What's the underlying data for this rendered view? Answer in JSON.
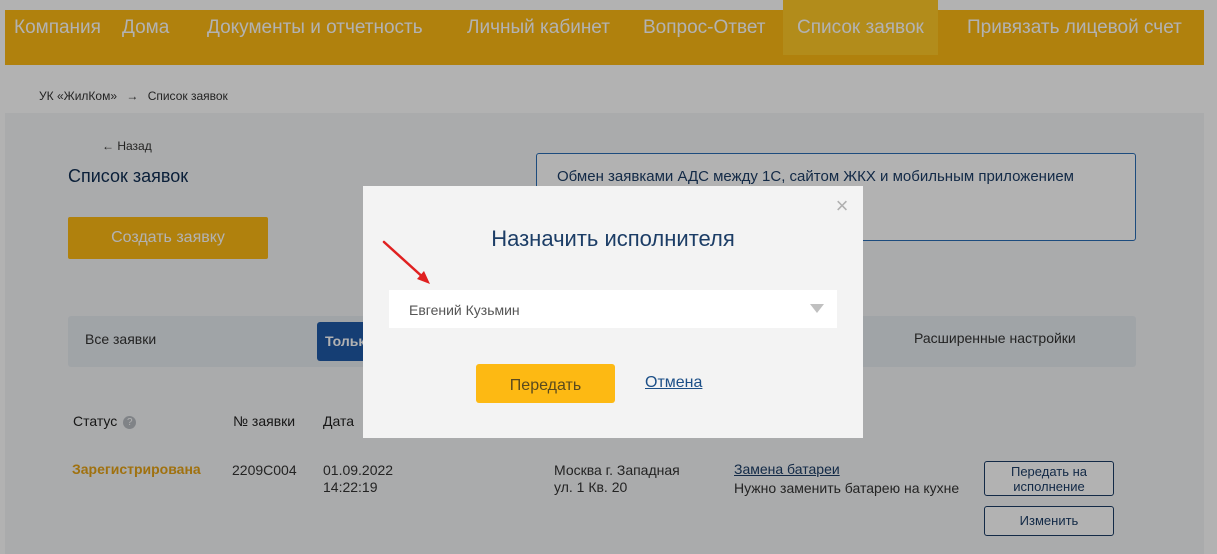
{
  "navbar": {
    "items": [
      {
        "label": "Компания"
      },
      {
        "label": "Дома"
      },
      {
        "label": "Документы и отчетность"
      },
      {
        "label": "Личный кабинет"
      },
      {
        "label": "Вопрос-Ответ"
      },
      {
        "label": "Список заявок",
        "active": true
      },
      {
        "label": "Привязать лицевой счет"
      }
    ]
  },
  "breadcrumb": {
    "home": "УК «ЖилКом»",
    "separator": "→",
    "current": "Список заявок"
  },
  "page": {
    "back_label": "← Назад",
    "title": "Список заявок",
    "create_button": "Создать заявку",
    "info_text": "Обмен заявками АДС между 1С, сайтом ЖКХ и мобильным приложением"
  },
  "filters": {
    "all": "Все заявки",
    "only": "Только",
    "advanced": "Расширенные настройки"
  },
  "table": {
    "headers": {
      "status": "Статус",
      "number": "№ заявки",
      "date": "Дата"
    },
    "rows": [
      {
        "status": "Зарегистрирована",
        "number": "2209С004",
        "date": "01.09.2022",
        "time": "14:22:19",
        "address_line1": "Москва г. Западная",
        "address_line2": "ул. 1 Кв. 20",
        "service": "Замена батареи",
        "description": "Нужно заменить батарею на кухне",
        "pass_button": "Передать на исполнение",
        "edit_button": "Изменить"
      }
    ]
  },
  "modal": {
    "title": "Назначить исполнителя",
    "selected_executor": "Евгений Кузьмин",
    "submit_button": "Передать",
    "cancel_link": "Отмена",
    "close_symbol": "×"
  },
  "colors": {
    "brand": "#fdb913",
    "primary": "#1c3d66",
    "accent_blue": "#1f5aa6",
    "annotation_arrow": "#e02020"
  }
}
